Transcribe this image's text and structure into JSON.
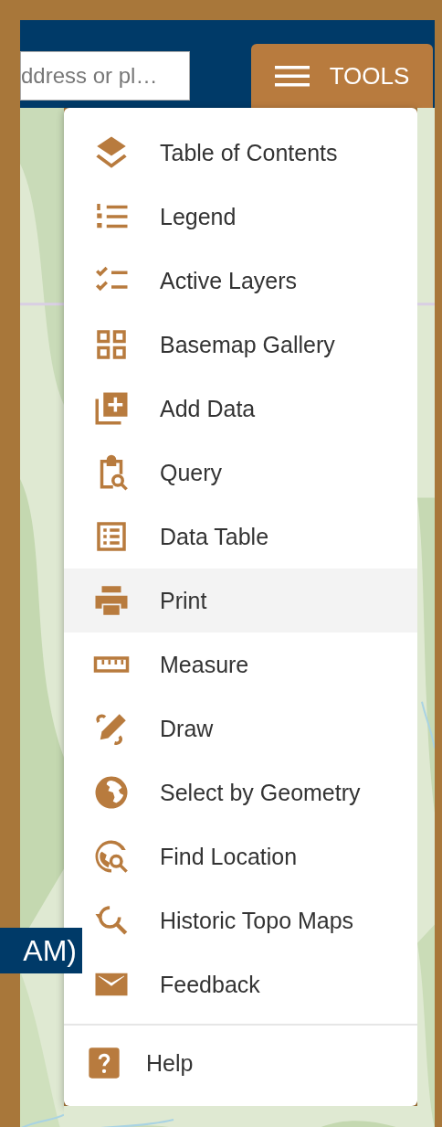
{
  "search": {
    "placeholder": "ddress or pl…"
  },
  "tools_button": {
    "label": "TOOLS"
  },
  "map_banner": {
    "text": "AM)"
  },
  "menu": {
    "items": [
      {
        "label": "Table of Contents",
        "selected": false
      },
      {
        "label": "Legend",
        "selected": false
      },
      {
        "label": "Active Layers",
        "selected": false
      },
      {
        "label": "Basemap Gallery",
        "selected": false
      },
      {
        "label": "Add Data",
        "selected": false
      },
      {
        "label": "Query",
        "selected": false
      },
      {
        "label": "Data Table",
        "selected": false
      },
      {
        "label": "Print",
        "selected": true
      },
      {
        "label": "Measure",
        "selected": false
      },
      {
        "label": "Draw",
        "selected": false
      },
      {
        "label": "Select by Geometry",
        "selected": false
      },
      {
        "label": "Find Location",
        "selected": false
      },
      {
        "label": "Historic Topo Maps",
        "selected": false
      },
      {
        "label": "Feedback",
        "selected": false
      }
    ],
    "footer_item": {
      "label": "Help"
    }
  }
}
